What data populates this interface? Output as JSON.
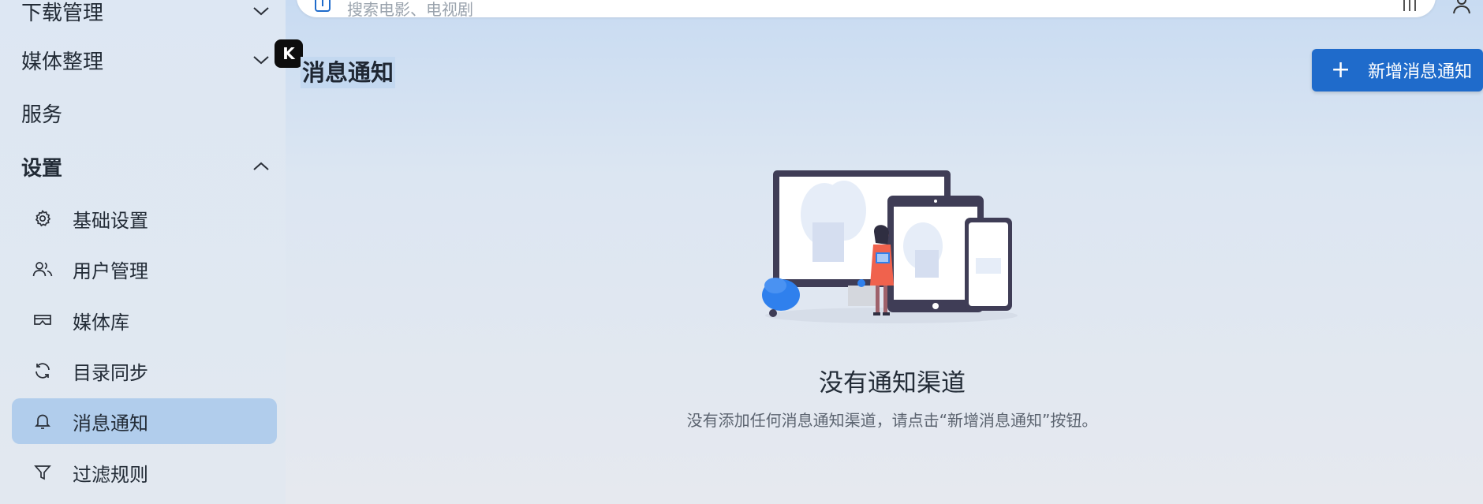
{
  "sidebar": {
    "items": [
      {
        "label": "下载管理"
      },
      {
        "label": "媒体整理"
      },
      {
        "label": "服务"
      },
      {
        "label": "设置"
      }
    ],
    "settings_sub": [
      {
        "label": "基础设置",
        "icon": "gear-icon"
      },
      {
        "label": "用户管理",
        "icon": "users-icon"
      },
      {
        "label": "媒体库",
        "icon": "vr-glasses-icon"
      },
      {
        "label": "目录同步",
        "icon": "sync-icon"
      },
      {
        "label": "消息通知",
        "icon": "bell-icon"
      },
      {
        "label": "过滤规则",
        "icon": "filter-icon"
      }
    ]
  },
  "search": {
    "placeholder": "搜索电影、电视剧"
  },
  "badge": {
    "label": "K"
  },
  "page": {
    "title": "消息通知",
    "add_button": "新增消息通知"
  },
  "empty": {
    "title": "没有通知渠道",
    "description": "没有添加任何消息通知渠道，请点击“新增消息通知”按钮。"
  },
  "colors": {
    "accent": "#1f6bcb",
    "active_bg": "#b1cdec",
    "illustration_dark": "#3f3d56",
    "illustration_blue": "#2f80ed",
    "illustration_accent": "#f0624d"
  }
}
